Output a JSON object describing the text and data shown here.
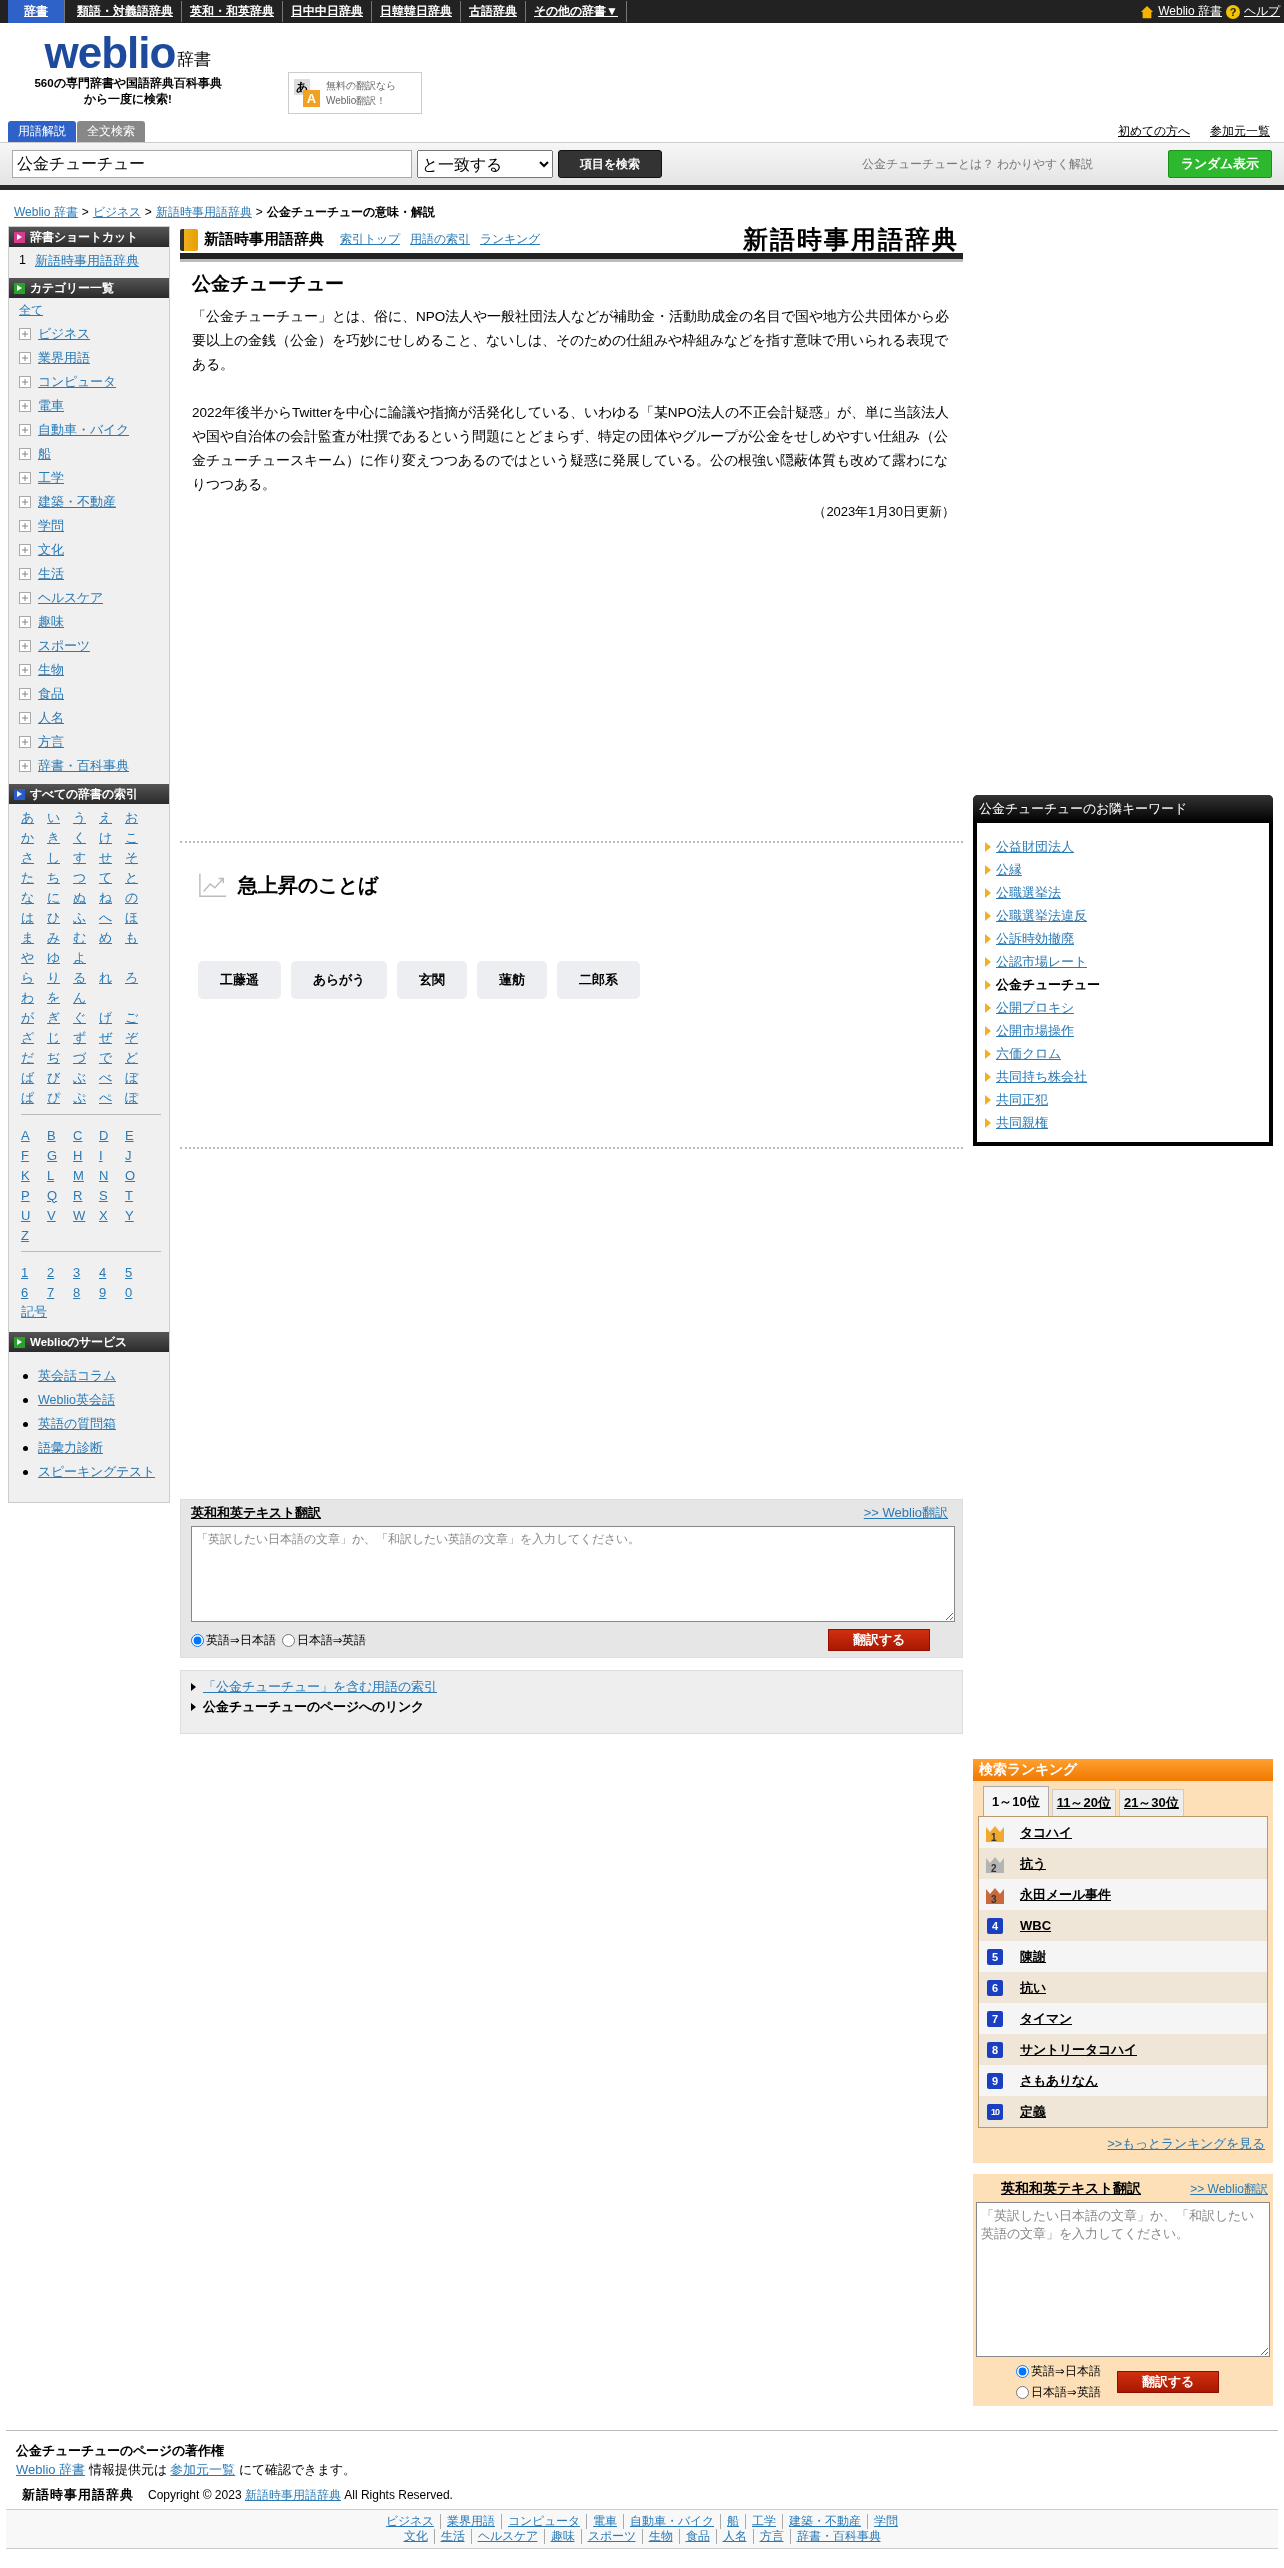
{
  "top_nav": {
    "items": [
      {
        "label": "辞書",
        "selected": true
      },
      {
        "label": "類語・対義語辞典",
        "selected": false
      },
      {
        "label": "英和・和英辞典",
        "selected": false
      },
      {
        "label": "日中中日辞典",
        "selected": false
      },
      {
        "label": "日韓韓日辞典",
        "selected": false
      },
      {
        "label": "古語辞典",
        "selected": false
      },
      {
        "label": "その他の辞書▼",
        "selected": false
      }
    ],
    "home_link": "Weblio 辞書",
    "help_icon": "?",
    "help_link": "ヘルプ"
  },
  "header": {
    "logo": "weblio",
    "logo_suffix": "辞書",
    "tagline": [
      "560の専門辞書や国語辞典百科事典",
      "から一度に検索!"
    ],
    "translate_ad": {
      "icon_letters": [
        "あ",
        "A"
      ],
      "lines": [
        "無料の翻訳なら",
        "Weblio翻訳！"
      ]
    }
  },
  "search_tabs": [
    {
      "label": "用語解説",
      "selected": true
    },
    {
      "label": "全文検索",
      "selected": false
    }
  ],
  "header_links": [
    "初めての方へ",
    "参加元一覧"
  ],
  "search": {
    "value": "公金チューチュー",
    "match_mode": "と一致する",
    "button": "項目を検索",
    "hint": "公金チューチューとは？ わかりやすく解説",
    "random_button": "ランダム表示"
  },
  "breadcrumb": {
    "separator": ">",
    "items": [
      {
        "label": "Weblio 辞書",
        "link": true
      },
      {
        "label": "ビジネス",
        "link": true
      },
      {
        "label": "新語時事用語辞典",
        "link": true
      },
      {
        "label": "公金チューチューの意味・解説",
        "link": false
      }
    ]
  },
  "sidebar": [
    {
      "kind": "shortcut",
      "title": "辞書ショートカット",
      "color": "#d63a8c",
      "items": [
        {
          "number": "1",
          "label": "新語時事用語辞典"
        }
      ]
    },
    {
      "kind": "categories",
      "title": "カテゴリー一覧",
      "color": "#2ca02c",
      "all": "全て",
      "items": [
        "ビジネス",
        "業界用語",
        "コンピュータ",
        "電車",
        "自動車・バイク",
        "船",
        "工学",
        "建築・不動産",
        "学問",
        "文化",
        "生活",
        "ヘルスケア",
        "趣味",
        "スポーツ",
        "生物",
        "食品",
        "人名",
        "方言",
        "辞書・百科事典"
      ]
    },
    {
      "kind": "index",
      "title": "すべての辞書の索引",
      "color": "#2a5cc8",
      "groups": [
        [
          [
            "あ",
            "い",
            "う",
            "え",
            "お"
          ],
          [
            "か",
            "き",
            "く",
            "け",
            "こ"
          ],
          [
            "さ",
            "し",
            "す",
            "せ",
            "そ"
          ],
          [
            "た",
            "ち",
            "つ",
            "て",
            "と"
          ],
          [
            "な",
            "に",
            "ぬ",
            "ね",
            "の"
          ],
          [
            "は",
            "ひ",
            "ふ",
            "へ",
            "ほ"
          ],
          [
            "ま",
            "み",
            "む",
            "め",
            "も"
          ],
          [
            "や",
            "ゆ",
            "よ"
          ],
          [
            "ら",
            "り",
            "る",
            "れ",
            "ろ"
          ],
          [
            "わ",
            "を",
            "ん"
          ],
          [
            "が",
            "ぎ",
            "ぐ",
            "げ",
            "ご"
          ],
          [
            "ざ",
            "じ",
            "ず",
            "ぜ",
            "ぞ"
          ],
          [
            "だ",
            "ぢ",
            "づ",
            "で",
            "ど"
          ],
          [
            "ば",
            "び",
            "ぶ",
            "べ",
            "ぼ"
          ],
          [
            "ぱ",
            "ぴ",
            "ぷ",
            "ぺ",
            "ぽ"
          ]
        ],
        [
          [
            "A",
            "B",
            "C",
            "D",
            "E"
          ],
          [
            "F",
            "G",
            "H",
            "I",
            "J"
          ],
          [
            "K",
            "L",
            "M",
            "N",
            "O"
          ],
          [
            "P",
            "Q",
            "R",
            "S",
            "T"
          ],
          [
            "U",
            "V",
            "W",
            "X",
            "Y"
          ],
          [
            "Z"
          ]
        ],
        [
          [
            "1",
            "2",
            "3",
            "4",
            "5"
          ],
          [
            "6",
            "7",
            "8",
            "9",
            "0"
          ],
          [
            "記号"
          ]
        ]
      ]
    },
    {
      "kind": "services",
      "title": "Weblioのサービス",
      "color": "#2ca02c",
      "items": [
        "英会話コラム",
        "Weblio英会話",
        "英語の質問箱",
        "語彙力診断",
        "スピーキングテスト"
      ]
    }
  ],
  "entry": {
    "dictionary": "新語時事用語辞典",
    "links": [
      "索引トップ",
      "用語の索引",
      "ランキング"
    ],
    "logo": "新語時事用語辞典",
    "title": "公金チューチュー",
    "paragraphs": [
      "「公金チューチュー」とは、俗に、NPO法人や一般社団法人などが補助金・活動助成金の名目で国や地方公共団体から必要以上の金銭（公金）を巧妙にせしめること、ないしは、そのための仕組みや枠組みなどを指す意味で用いられる表現である。",
      "2022年後半からTwitterを中心に論議や指摘が活発化している、いわゆる「某NPO法人の不正会計疑惑」が、単に当該法人や国や自治体の会計監査が杜撰であるという問題にとどまらず、特定の団体やグループが公金をせしめやすい仕組み（公金チューチュースキーム）に作り変えつつあるのではという疑惑に発展している。公の根強い隠蔽体質も改めて露わになりつつある。"
    ],
    "updated": "（2023年1月30日更新）"
  },
  "trending": {
    "title": "急上昇のことば",
    "words": [
      "工藤遥",
      "あらがう",
      "玄関",
      "蓮舫",
      "二郎系"
    ]
  },
  "translate": {
    "title": "英和和英テキスト翻訳",
    "link": ">> Weblio翻訳",
    "placeholder": "「英訳したい日本語の文章」か、「和訳したい英語の文章」を入力してください。",
    "options": [
      {
        "label": "英語⇒日本語",
        "selected": true
      },
      {
        "label": "日本語⇒英語",
        "selected": false
      }
    ],
    "button": "翻訳する"
  },
  "related_links": [
    {
      "label": "「公金チューチュー」を含む用語の索引",
      "link": true
    },
    {
      "label": "公金チューチューのページへのリンク",
      "link": false
    }
  ],
  "neighbors": {
    "title": "公金チューチューのお隣キーワード",
    "items": [
      {
        "label": "公益財団法人",
        "selected": false
      },
      {
        "label": "公縁",
        "selected": false
      },
      {
        "label": "公職選挙法",
        "selected": false
      },
      {
        "label": "公職選挙法違反",
        "selected": false
      },
      {
        "label": "公訴時効撤廃",
        "selected": false
      },
      {
        "label": "公認市場レート",
        "selected": false
      },
      {
        "label": "公金チューチュー",
        "selected": true
      },
      {
        "label": "公開プロキシ",
        "selected": false
      },
      {
        "label": "公開市場操作",
        "selected": false
      },
      {
        "label": "六価クロム",
        "selected": false
      },
      {
        "label": "共同持ち株会社",
        "selected": false
      },
      {
        "label": "共同正犯",
        "selected": false
      },
      {
        "label": "共同親権",
        "selected": false
      }
    ]
  },
  "ranking": {
    "title": "検索ランキング",
    "tabs": [
      {
        "label": "1～10位",
        "selected": true
      },
      {
        "label": "11～20位",
        "selected": false
      },
      {
        "label": "21～30位",
        "selected": false
      }
    ],
    "items": [
      {
        "rank": "1",
        "label": "タコハイ",
        "kind": "crown",
        "color": "#f2a930"
      },
      {
        "rank": "2",
        "label": "抗う",
        "kind": "crown",
        "color": "#b4b4b4"
      },
      {
        "rank": "3",
        "label": "永田メール事件",
        "kind": "crown",
        "color": "#c86a3c"
      },
      {
        "rank": "4",
        "label": "WBC",
        "kind": "number"
      },
      {
        "rank": "5",
        "label": "陳謝",
        "kind": "number"
      },
      {
        "rank": "6",
        "label": "抗い",
        "kind": "number"
      },
      {
        "rank": "7",
        "label": "タイマン",
        "kind": "number"
      },
      {
        "rank": "8",
        "label": "サントリータコハイ",
        "kind": "number"
      },
      {
        "rank": "9",
        "label": "さもありなん",
        "kind": "number"
      },
      {
        "rank": "10",
        "label": "定義",
        "kind": "number"
      }
    ],
    "more": ">>もっとランキングを見る"
  },
  "side_translate": {
    "title": "英和和英テキスト翻訳",
    "link": ">> Weblio翻訳",
    "placeholder": "「英訳したい日本語の文章」か、「和訳したい英語の文章」を入力してください。",
    "options": [
      {
        "label": "英語⇒日本語",
        "selected": true
      },
      {
        "label": "日本語⇒英語",
        "selected": false
      }
    ],
    "button": "翻訳する"
  },
  "footer": {
    "copyright_title": "公金チューチューのページの著作権",
    "notice": [
      {
        "text": "Weblio 辞書",
        "link": true
      },
      {
        "text": " 情報提供元は ",
        "link": false
      },
      {
        "text": "参加元一覧",
        "link": true
      },
      {
        "text": " にて確認できます。",
        "link": false
      }
    ],
    "logo": "新語時事用語辞典",
    "copyright": [
      {
        "text": "Copyright © 2023 ",
        "link": false
      },
      {
        "text": "新語時事用語辞典",
        "link": true
      },
      {
        "text": " All Rights Reserved.",
        "link": false
      }
    ],
    "category_links": [
      [
        "ビジネス",
        "業界用語",
        "コンピュータ",
        "電車",
        "自動車・バイク",
        "船",
        "工学",
        "建築・不動産",
        "学問"
      ],
      [
        "文化",
        "生活",
        "ヘルスケア",
        "趣味",
        "スポーツ",
        "生物",
        "食品",
        "人名",
        "方言",
        "辞書・百科事典"
      ]
    ]
  }
}
